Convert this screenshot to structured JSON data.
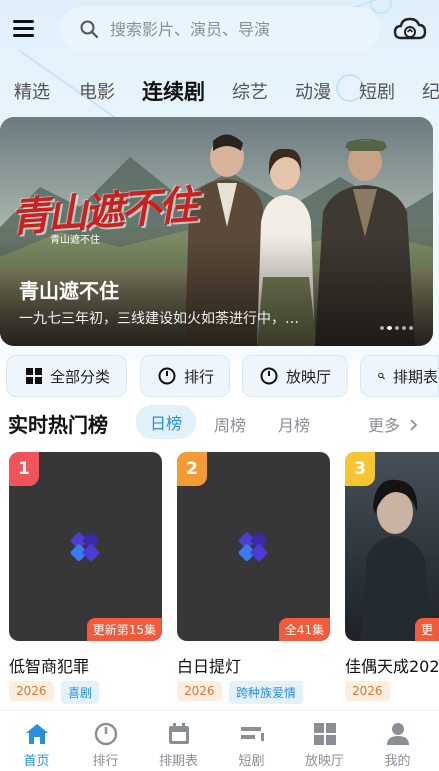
{
  "search": {
    "placeholder": "搜索影片、演员、导演"
  },
  "tabs": [
    {
      "label": "精选",
      "active": false
    },
    {
      "label": "电影",
      "active": false
    },
    {
      "label": "连续剧",
      "active": true
    },
    {
      "label": "综艺",
      "active": false
    },
    {
      "label": "动漫",
      "active": false
    },
    {
      "label": "短剧",
      "active": false
    },
    {
      "label": "纪",
      "active": false
    }
  ],
  "banner": {
    "logo_text": "青山遮不住",
    "logo_sub": "青山遮不住",
    "title": "青山遮不住",
    "description": "一九七三年初，三线建设如火如荼进行中，…",
    "page_count": 5,
    "current_page": 2
  },
  "quick_links": [
    {
      "label": "全部分类",
      "icon": "grid-icon"
    },
    {
      "label": "排行",
      "icon": "circle-icon"
    },
    {
      "label": "放映厅",
      "icon": "circle-icon"
    },
    {
      "label": "排期表",
      "icon": "search-icon"
    }
  ],
  "hot": {
    "title": "实时热门榜",
    "tabs": [
      {
        "label": "日榜",
        "active": true
      },
      {
        "label": "周榜",
        "active": false
      },
      {
        "label": "月榜",
        "active": false
      }
    ],
    "more_label": "更多"
  },
  "cards": [
    {
      "rank": "1",
      "status": "更新第15集",
      "name": "低智商犯罪",
      "year": "2026",
      "genre": "喜剧",
      "rank_color": "#f0545a"
    },
    {
      "rank": "2",
      "status": "全41集",
      "name": "白日提灯",
      "year": "2026",
      "genre": "跨种族爱情",
      "rank_color": "#f59b35"
    },
    {
      "rank": "3",
      "status": "更",
      "name": "佳偶天成202",
      "year": "2026",
      "genre": "",
      "rank_color": "#f6c531"
    }
  ],
  "colors": {
    "accent": "#2a8fe0",
    "status_badge": "#f15a3a",
    "year_tag_bg": "#fdeee2",
    "genre_tag_bg": "#e4f1fb"
  },
  "bottom_nav": [
    {
      "label": "首页",
      "icon": "home-icon",
      "active": true
    },
    {
      "label": "排行",
      "icon": "circle-icon",
      "active": false
    },
    {
      "label": "排期表",
      "icon": "calendar-icon",
      "active": false
    },
    {
      "label": "短剧",
      "icon": "short-drama-icon",
      "active": false
    },
    {
      "label": "放映厅",
      "icon": "grid-icon",
      "active": false
    },
    {
      "label": "我的",
      "icon": "user-icon",
      "active": false
    }
  ]
}
